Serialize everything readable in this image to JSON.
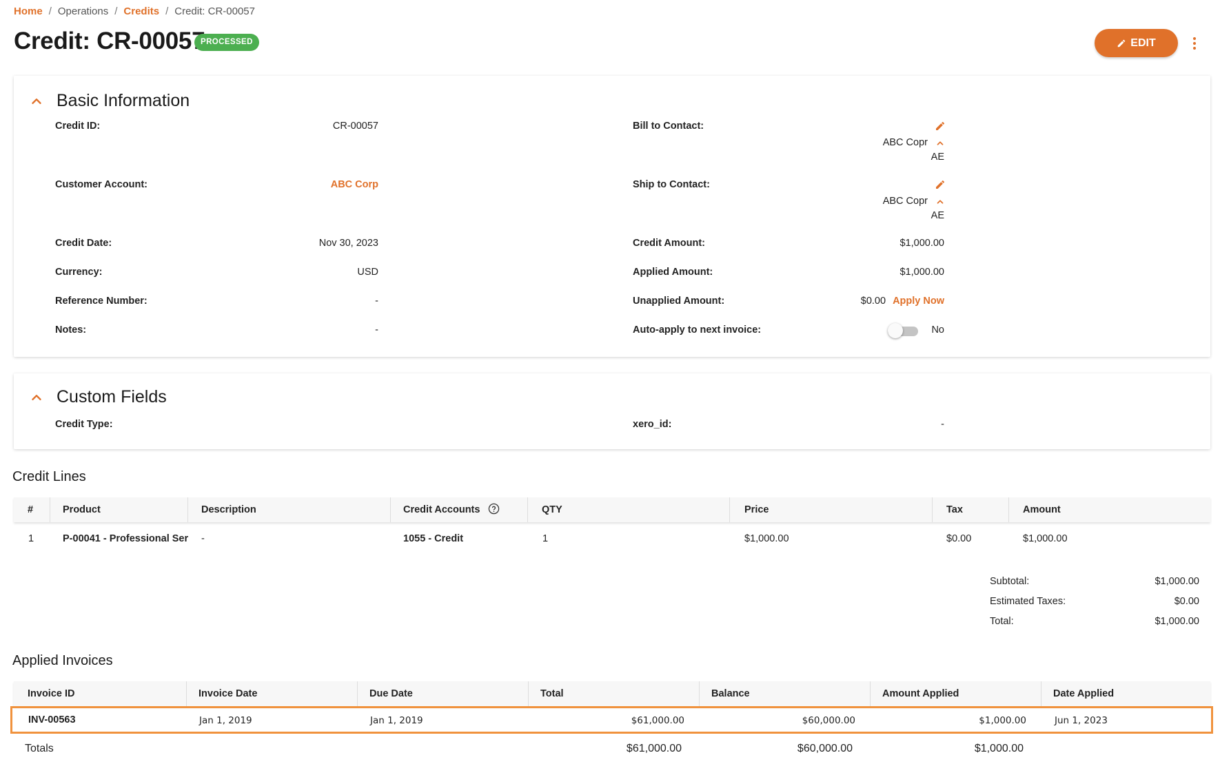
{
  "breadcrumb": {
    "home": "Home",
    "operations": "Operations",
    "credits": "Credits",
    "current": "Credit: CR-00057",
    "separator": "/"
  },
  "header": {
    "title": "Credit: CR-00057",
    "status": "PROCESSED",
    "edit_label": "EDIT"
  },
  "basic_info": {
    "title": "Basic Information",
    "credit_id_label": "Credit ID:",
    "credit_id": "CR-00057",
    "customer_account_label": "Customer Account:",
    "customer_account": "ABC Corp",
    "credit_date_label": "Credit Date:",
    "credit_date": "Nov 30, 2023",
    "currency_label": "Currency:",
    "currency": "USD",
    "reference_number_label": "Reference Number:",
    "reference_number": "-",
    "notes_label": "Notes:",
    "notes": "-",
    "bill_to_label": "Bill to Contact:",
    "bill_to_name": "ABC Copr",
    "bill_to_sub": "AE",
    "ship_to_label": "Ship to Contact:",
    "ship_to_name": "ABC Copr",
    "ship_to_sub": "AE",
    "credit_amount_label": "Credit Amount:",
    "credit_amount": "$1,000.00",
    "applied_amount_label": "Applied Amount:",
    "applied_amount": "$1,000.00",
    "unapplied_amount_label": "Unapplied Amount:",
    "unapplied_amount": "$0.00",
    "apply_now": "Apply Now",
    "auto_apply_label": "Auto-apply to next invoice:",
    "auto_apply_value": "No"
  },
  "custom_fields": {
    "title": "Custom Fields",
    "credit_type_label": "Credit Type:",
    "credit_type": "",
    "xero_id_label": "xero_id:",
    "xero_id": "-"
  },
  "credit_lines": {
    "title": "Credit Lines",
    "columns": [
      "#",
      "Product",
      "Description",
      "Credit Accounts",
      "QTY",
      "Price",
      "Tax",
      "Amount"
    ],
    "rows": [
      {
        "num": "1",
        "product": "P-00041 - Professional Ser",
        "description": "-",
        "credit_account": "1055 - Credit",
        "qty": "1",
        "price": "$1,000.00",
        "tax": "$0.00",
        "amount": "$1,000.00"
      }
    ],
    "summary": {
      "subtotal_label": "Subtotal:",
      "subtotal": "$1,000.00",
      "taxes_label": "Estimated Taxes:",
      "taxes": "$0.00",
      "total_label": "Total:",
      "total": "$1,000.00"
    }
  },
  "applied_invoices": {
    "title": "Applied Invoices",
    "columns": [
      "Invoice ID",
      "Invoice Date",
      "Due Date",
      "Total",
      "Balance",
      "Amount Applied",
      "Date Applied"
    ],
    "rows": [
      {
        "invoice_id": "INV-00563",
        "invoice_date": "Jan 1, 2019",
        "due_date": "Jan 1, 2019",
        "total": "$61,000.00",
        "balance": "$60,000.00",
        "amount_applied": "$1,000.00",
        "date_applied": "Jun 1, 2023"
      }
    ],
    "totals": {
      "label": "Totals",
      "total": "$61,000.00",
      "balance": "$60,000.00",
      "amount_applied": "$1,000.00"
    }
  },
  "colors": {
    "accent": "#e0712a",
    "status_green": "#4caf50",
    "highlight": "#f0923d"
  },
  "icons": [
    "pencil-icon",
    "chevron-up-icon",
    "help-circle-icon",
    "more-vert-icon"
  ]
}
